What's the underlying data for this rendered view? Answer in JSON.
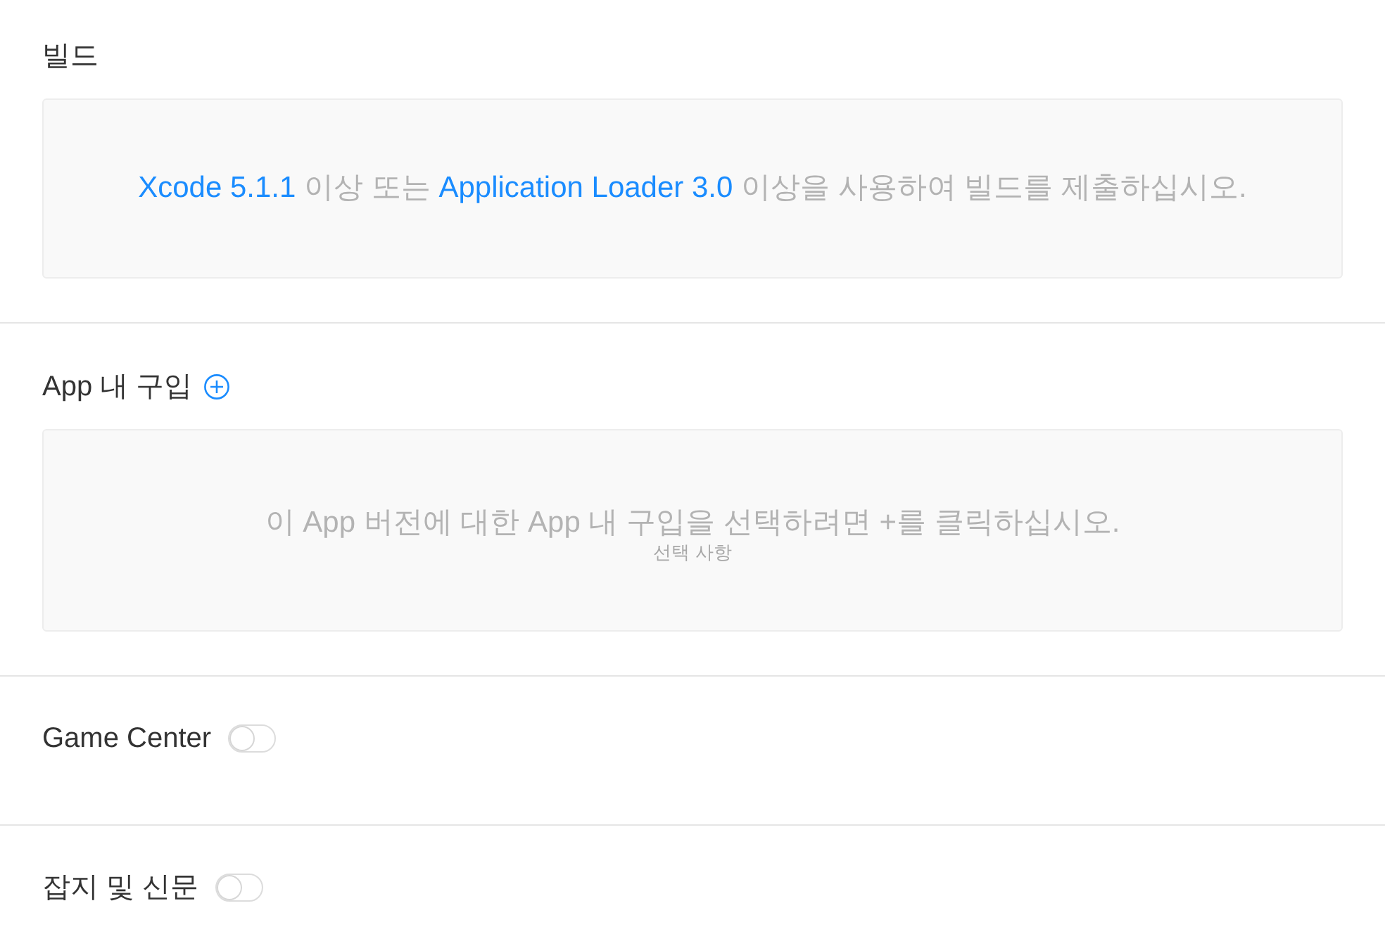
{
  "sections": [
    {
      "kind": "panel",
      "title": "빌드",
      "message": [
        {
          "kind": "link",
          "text": "Xcode 5.1.1"
        },
        {
          "kind": "text",
          "text": " 이상 또는 "
        },
        {
          "kind": "link",
          "text": "Application Loader 3.0"
        },
        {
          "kind": "text",
          "text": " 이상을 사용하여 빌드를 제출하십시오."
        }
      ]
    },
    {
      "kind": "panel",
      "title": "App 내 구입",
      "add_button": true,
      "message": [
        {
          "kind": "text",
          "text": "이 App 버전에 대한 App 내 구입을 선택하려면 +를 클릭하십시오."
        }
      ],
      "note": "선택 사항"
    },
    {
      "kind": "toggle",
      "title": "Game Center",
      "on": false
    },
    {
      "kind": "toggle",
      "title": "잡지 및 신문",
      "on": false
    }
  ]
}
